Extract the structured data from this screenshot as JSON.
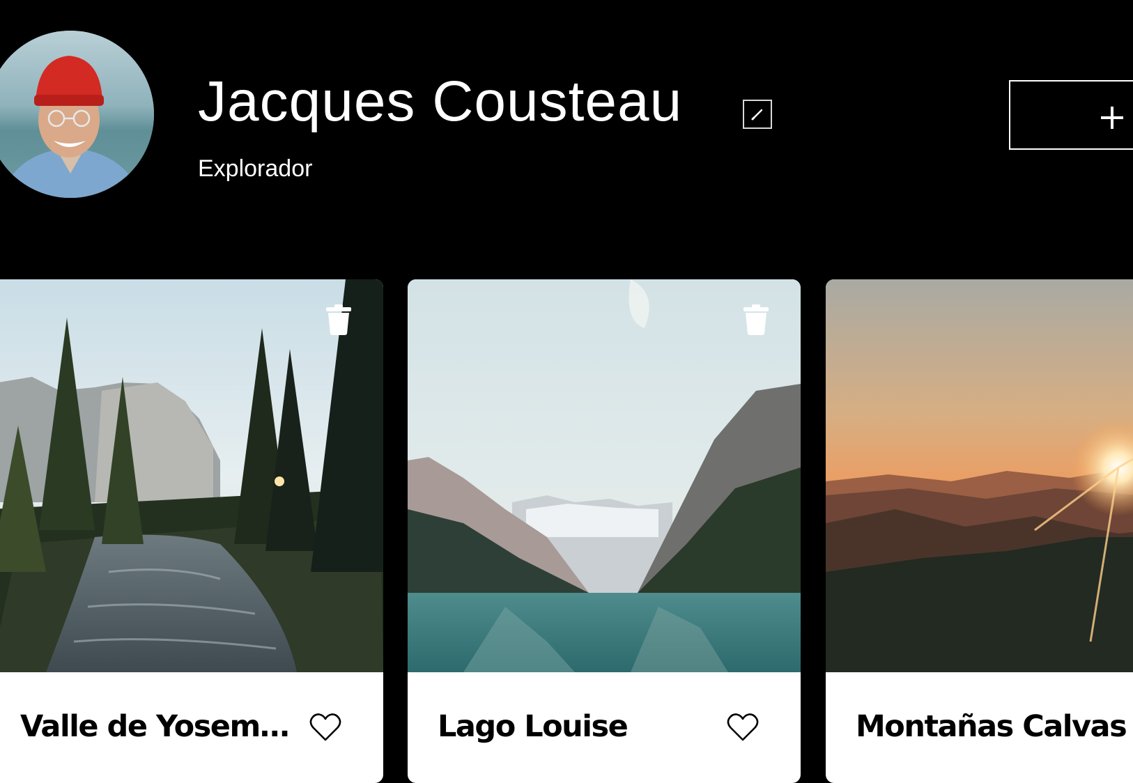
{
  "profile": {
    "name": "Jacques Cousteau",
    "about": "Explorador",
    "avatar_icon": "portrait-photo"
  },
  "icons": {
    "edit": "pencil-icon",
    "add": "plus-icon",
    "delete": "trash-icon",
    "like": "heart-icon"
  },
  "cards": [
    {
      "title": "Valle de Yosemite",
      "liked": false
    },
    {
      "title": "Lago Louise",
      "liked": false
    },
    {
      "title": "Montañas Calvas",
      "liked": false
    }
  ],
  "colors": {
    "background": "#000000",
    "text": "#ffffff",
    "card": "#ffffff",
    "card_text": "#000000"
  }
}
